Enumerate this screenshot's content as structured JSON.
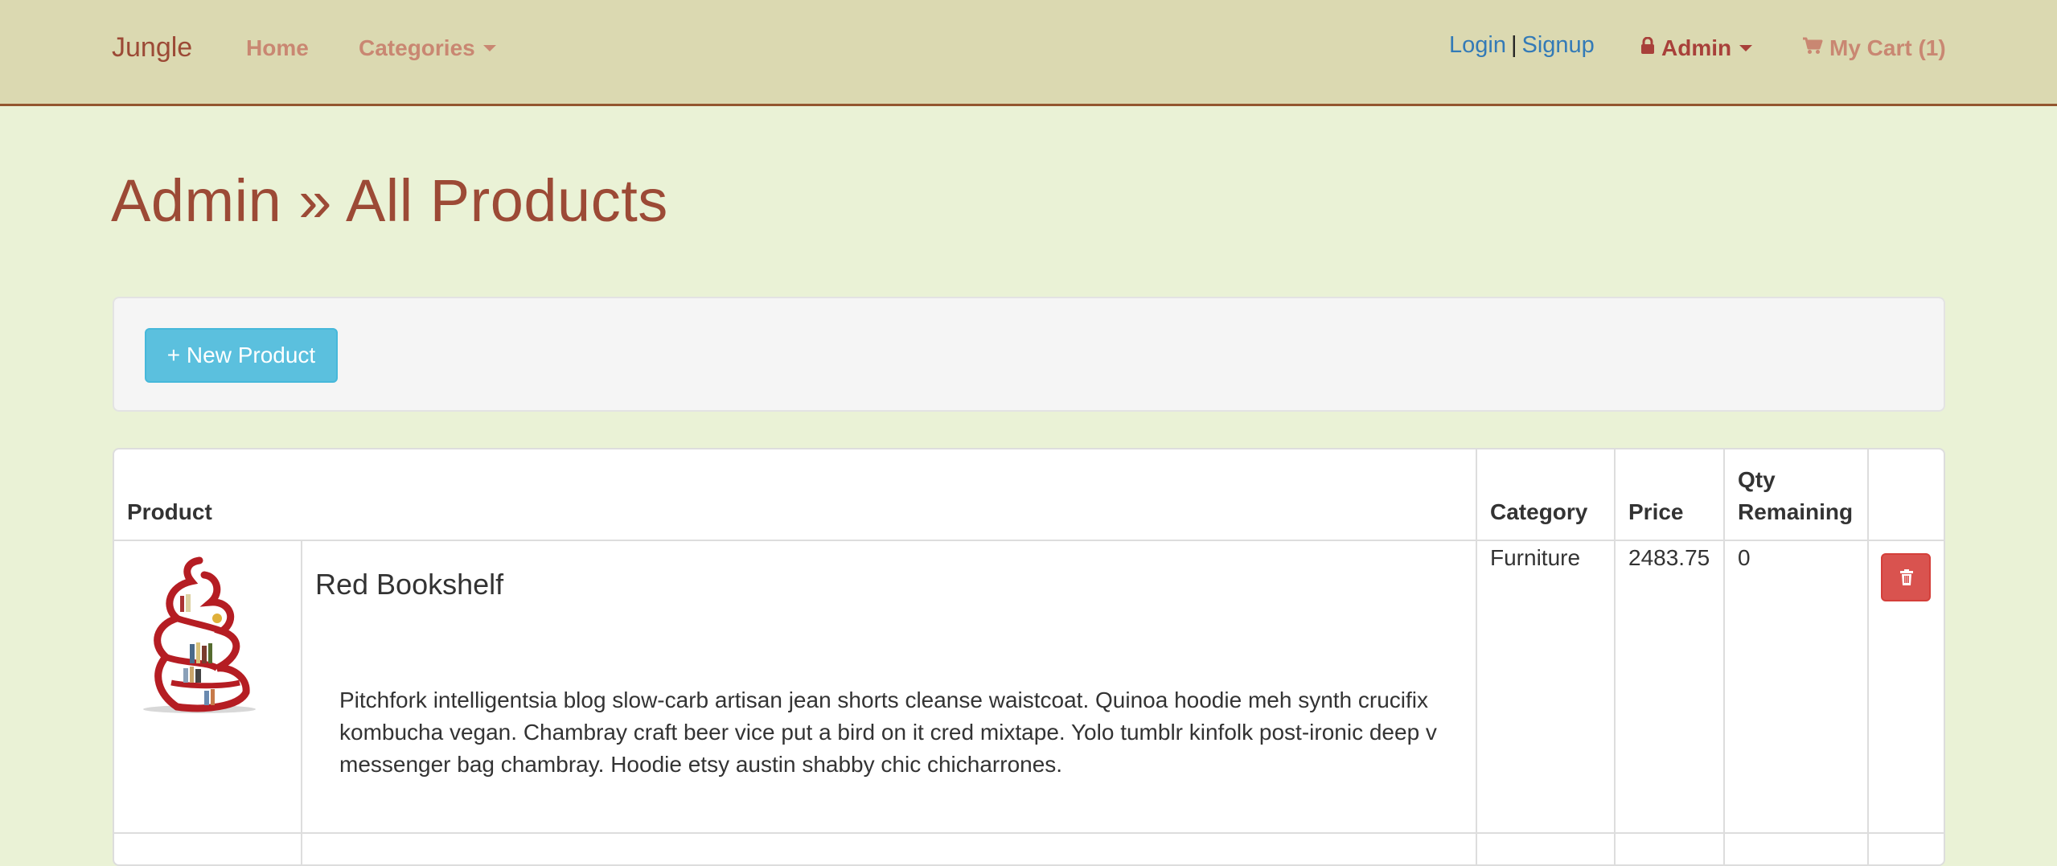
{
  "navbar": {
    "brand": "Jungle",
    "home": "Home",
    "categories": "Categories",
    "login": "Login",
    "separator": "|",
    "signup": "Signup",
    "admin": "Admin",
    "cart": "My Cart (1)"
  },
  "page": {
    "title": "Admin » All Products"
  },
  "toolbar": {
    "new_product_label": "+ New Product"
  },
  "table": {
    "headers": {
      "product": "Product",
      "category": "Category",
      "price": "Price",
      "qty_line1": "Qty",
      "qty_line2": "Remaining"
    },
    "rows": [
      {
        "image": "red-bookshelf-image",
        "name": "Red Bookshelf",
        "description": "Pitchfork intelligentsia blog slow-carb artisan jean shorts cleanse waistcoat. Quinoa hoodie meh synth crucifix kombucha vegan. Chambray craft beer vice put a bird on it cred mixtape. Yolo tumblr kinfolk post-ironic deep v messenger bag chambray. Hoodie etsy austin shabby chic chicharrones.",
        "category": "Furniture",
        "price": "2483.75",
        "quantity": "0",
        "delete_icon": "trash-icon"
      }
    ]
  },
  "colors": {
    "navbar_bg": "#dbd9b1",
    "page_bg": "#eaf2d6",
    "title": "#9c4a36",
    "link_blue": "#337ab7",
    "info_button": "#5bc0de",
    "danger_button": "#d9534f"
  }
}
